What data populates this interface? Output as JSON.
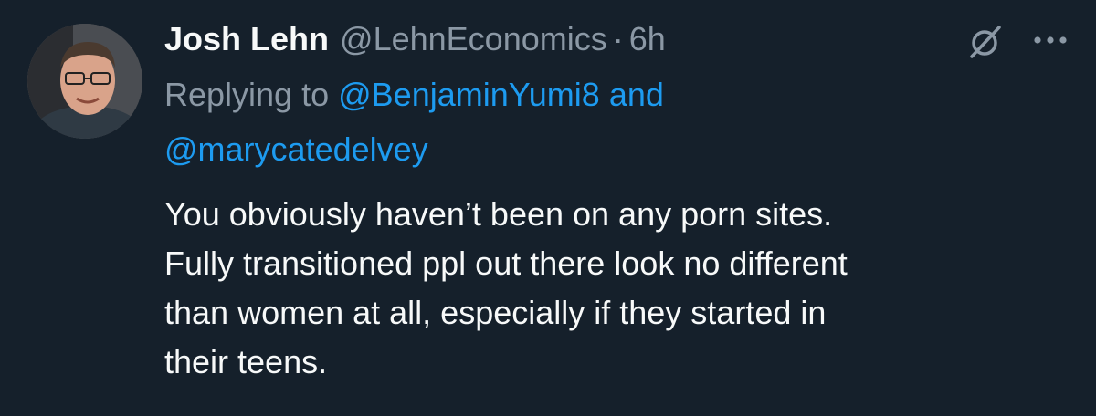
{
  "tweet": {
    "display_name": "Josh Lehn",
    "handle": "@LehnEconomics",
    "separator": "·",
    "time": "6h",
    "replying_prefix": "Replying to",
    "reply_mention_1": "@BenjaminYumi8",
    "reply_and": "and",
    "reply_mention_2": "@marycatedelvey",
    "body_line_1": "You obviously haven’t been on any porn sites.",
    "body_line_2": "Fully transitioned ppl out there look no different",
    "body_line_3": "than women at all, especially if they started in",
    "body_line_4": "their teens."
  },
  "icons": {
    "avatar": "avatar-photo",
    "grok": "grok-icon",
    "more": "more-icon"
  },
  "colors": {
    "background": "#15202b",
    "primary_text": "#f7f9f9",
    "secondary_text": "#8b98a5",
    "accent": "#1d9bf0"
  }
}
